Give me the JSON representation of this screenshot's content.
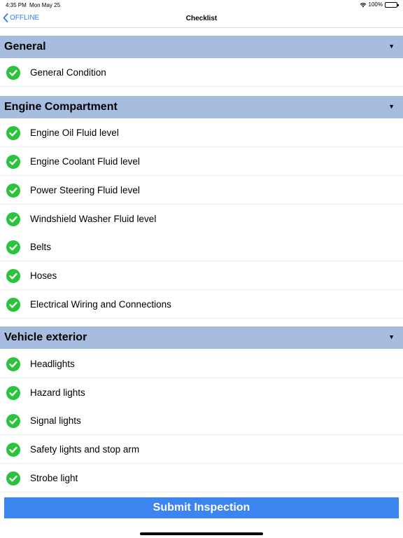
{
  "status_bar": {
    "time": "4:35 PM",
    "date": "Mon May 25",
    "battery": "100%",
    "wifi_icon": "wifi-icon",
    "battery_icon": "battery-icon"
  },
  "nav": {
    "back_label": "OFFLINE",
    "back_icon": "chevron-left-icon",
    "title": "Checklist"
  },
  "sections": [
    {
      "title": "General",
      "items": [
        "General Condition"
      ]
    },
    {
      "title": "Engine Compartment",
      "items": [
        "Engine Oil Fluid level",
        "Engine Coolant Fluid level",
        "Power Steering Fluid level",
        "Windshield Washer Fluid level",
        "Belts",
        "Hoses",
        "Electrical Wiring and Connections"
      ]
    },
    {
      "title": "Vehicle exterior",
      "items": [
        "Headlights",
        "Hazard lights",
        "Signal lights",
        "Safety lights and stop arm",
        "Strobe light"
      ]
    }
  ],
  "colors": {
    "accent": "#2f7cf6",
    "section_header": "#a7bddf",
    "check_green": "#2ac33b",
    "submit_button": "#3c84ee"
  },
  "submit_label": "Submit Inspection"
}
